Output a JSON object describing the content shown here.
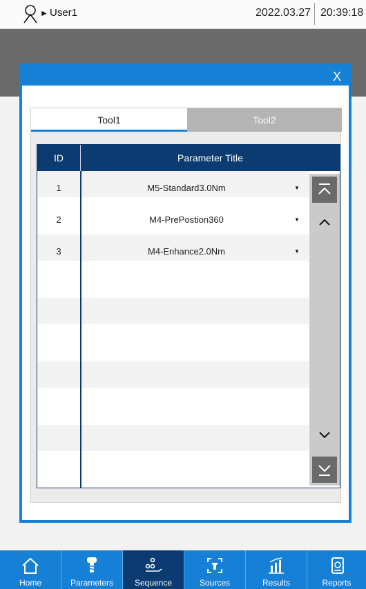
{
  "status": {
    "user_arrow": "►",
    "user": "User1",
    "date": "2022.03.27",
    "time": "20:39:18"
  },
  "dialog": {
    "close": "X",
    "tabs": [
      "Tool1",
      "Tool2"
    ],
    "active_tab": "Tool1",
    "table": {
      "headers": [
        "ID",
        "Parameter Title"
      ],
      "rows": [
        {
          "id": "1",
          "title": "M5-Standard3.0Nm"
        },
        {
          "id": "2",
          "title": "M4-PrePostion360"
        },
        {
          "id": "3",
          "title": "M4-Enhance2.0Nm"
        }
      ],
      "caret": "▼"
    }
  },
  "nav": {
    "items": [
      {
        "label": "Home",
        "icon": "home-icon"
      },
      {
        "label": "Parameters",
        "icon": "screw-icon"
      },
      {
        "label": "Sequence",
        "icon": "sequence-icon"
      },
      {
        "label": "Sources",
        "icon": "sources-icon"
      },
      {
        "label": "Results",
        "icon": "results-icon"
      },
      {
        "label": "Reports",
        "icon": "reports-icon"
      }
    ],
    "active": "Sequence"
  },
  "colors": {
    "accent": "#1680d7",
    "header_navy": "#0b3b70",
    "backdrop": "#6a6a6a"
  }
}
